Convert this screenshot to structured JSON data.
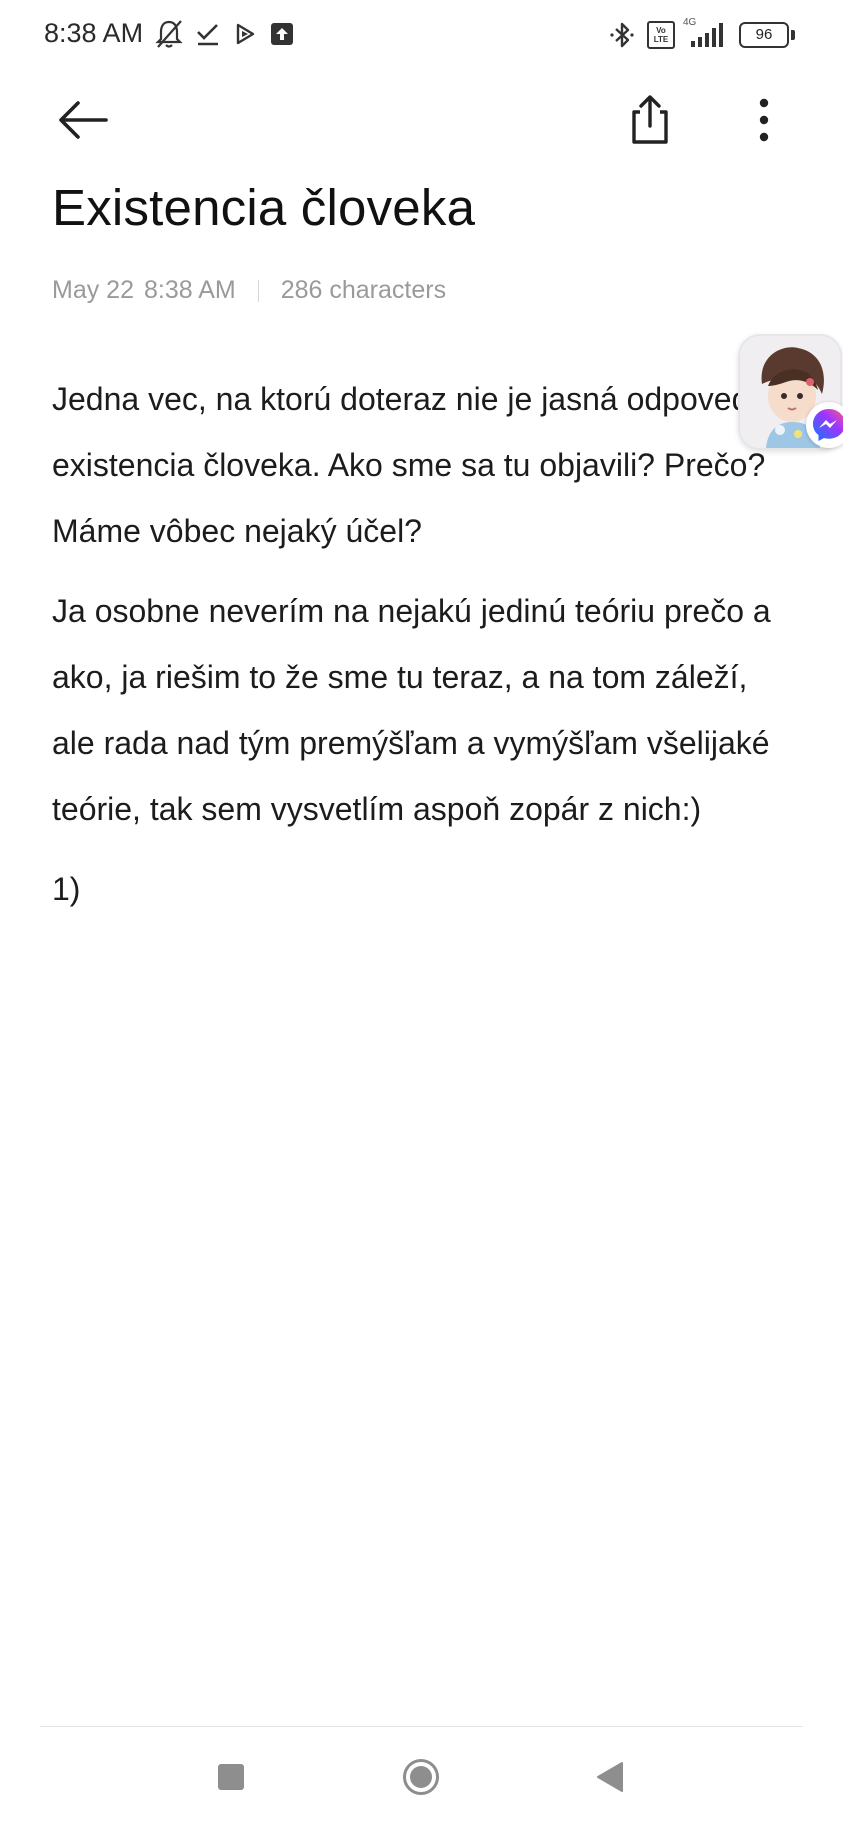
{
  "status_bar": {
    "time": "8:38 AM",
    "icons_left": [
      "bell-off-icon",
      "check-icon",
      "play-store-icon",
      "upload-icon"
    ],
    "icons_right": [
      "bluetooth-icon",
      "volte-icon",
      "signal-icon",
      "battery-icon"
    ],
    "volte_line1": "Vo",
    "volte_line2": "LTE",
    "network_type": "4G",
    "battery_level": "96"
  },
  "toolbar": {
    "back_icon": "arrow-left-icon",
    "share_icon": "share-icon",
    "more_icon": "more-vertical-icon"
  },
  "note": {
    "title": "Existencia človeka",
    "date": "May 22",
    "time": "8:38 AM",
    "char_count": "286 characters",
    "paragraphs": [
      "Jedna vec, na ktorú doteraz nie je jasná odpoveď, je existencia človeka. Ako sme sa tu objavili? Prečo? Máme vôbec nejaký účel?",
      "Ja osobne neverím na nejakú jedinú teóriu prečo a ako, ja riešim to že sme tu teraz, a na tom záleží, ale rada nad tým premýšľam a vymýšľam všelijaké teórie, tak sem vysvetlím aspoň zopár z nich:)",
      "1)"
    ]
  },
  "overlay": {
    "chat_head": "avatar",
    "badge": "messenger-icon"
  },
  "nav_bar": {
    "buttons": [
      "recents-button",
      "home-button",
      "back-button"
    ]
  },
  "colors": {
    "background": "#ffffff",
    "text": "#1c1c1c",
    "meta_text": "#9a9a9a",
    "icon": "#333333"
  }
}
